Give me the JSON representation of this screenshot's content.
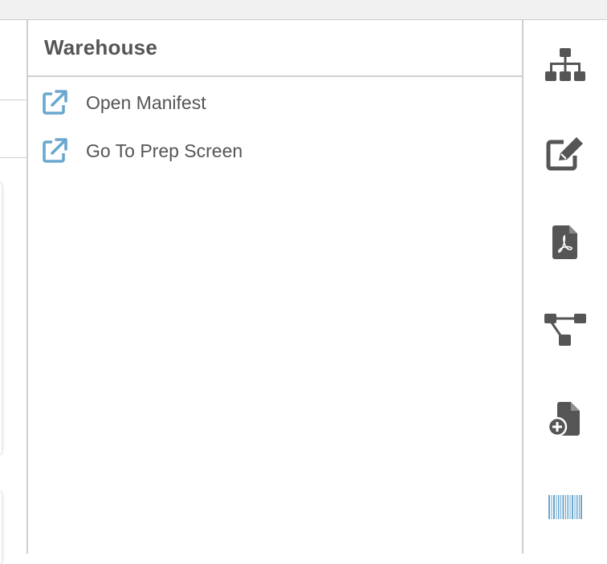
{
  "panel": {
    "title": "Warehouse",
    "items": [
      {
        "label": "Open Manifest",
        "icon": "external-link-icon"
      },
      {
        "label": "Go To Prep Screen",
        "icon": "external-link-icon"
      }
    ]
  },
  "toolbar": {
    "icons": [
      "sitemap-icon",
      "edit-icon",
      "pdf-file-icon",
      "workflow-icon",
      "add-document-icon",
      "barcode-icon"
    ]
  },
  "colors": {
    "accent": "#6aa7cf",
    "icon_dark": "#555555",
    "text": "#555555",
    "border": "#cfcfcf",
    "topbar": "#f1f1f1"
  }
}
